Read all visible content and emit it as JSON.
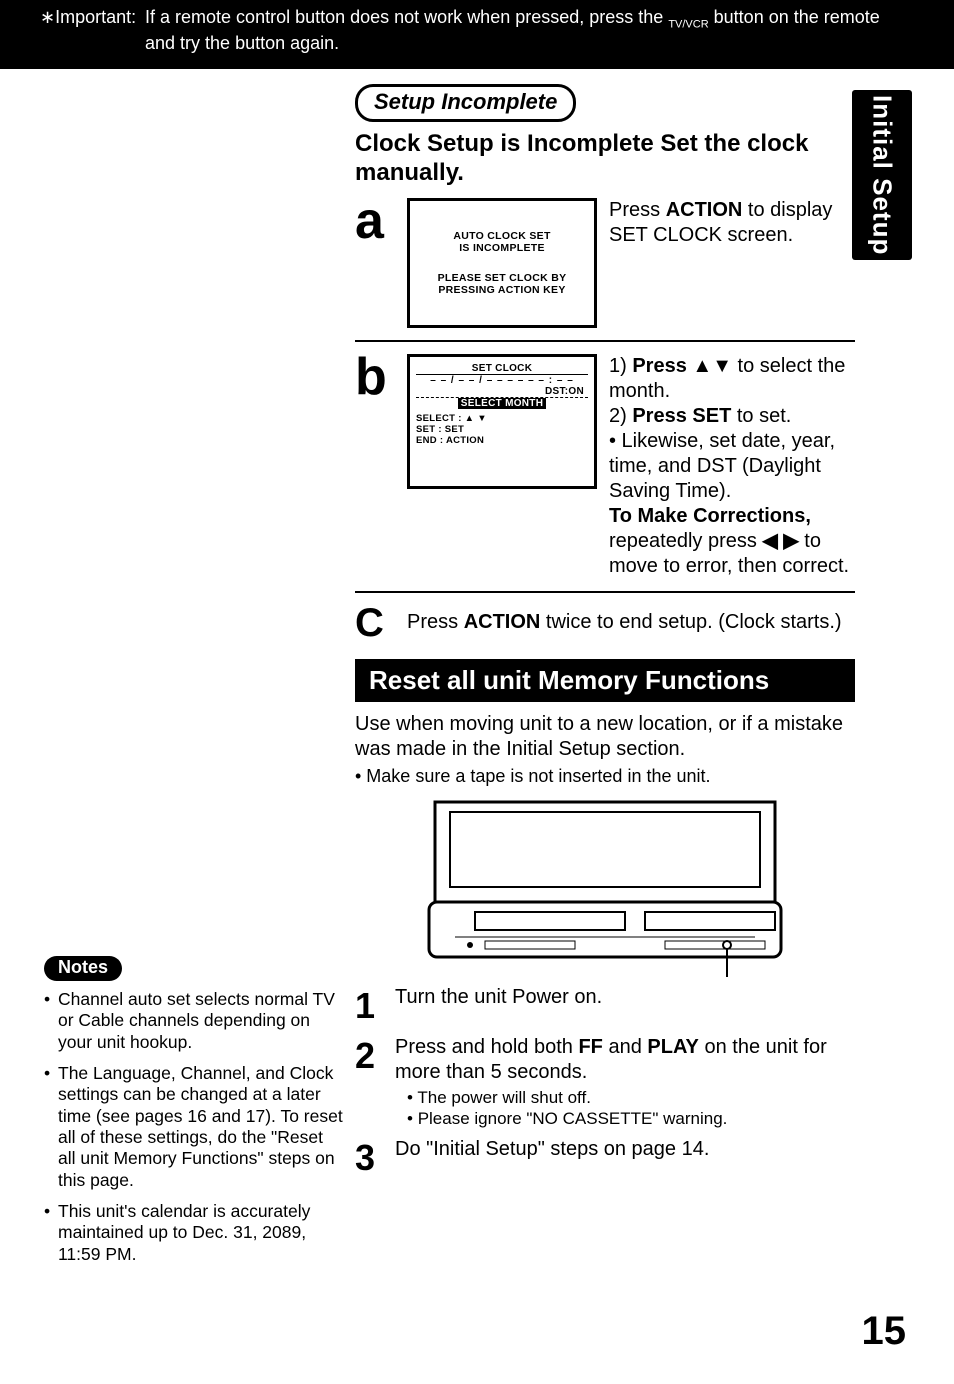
{
  "banner": {
    "prefix": "∗Important:",
    "text_part1": "If a remote control button does not work when pressed, press the ",
    "tvvcr": "TV/VCR",
    "text_part2": " button on the remote and try the button again."
  },
  "side_tab": "Initial Setup",
  "setup_incomplete": {
    "pill": "Setup Incomplete",
    "heading": "Clock Setup is Incomplete Set the clock manually.",
    "step_a": {
      "letter": "a",
      "osd_line1": "AUTO CLOCK SET",
      "osd_line2": "IS INCOMPLETE",
      "osd_line3": "PLEASE SET CLOCK BY",
      "osd_line4": "PRESSING ACTION KEY",
      "desc_prefix": "Press ",
      "desc_bold": "ACTION",
      "desc_suffix": " to display SET CLOCK screen."
    },
    "step_b": {
      "letter": "b",
      "osd_title": "SET CLOCK",
      "osd_dashes": "– – / – – / – – – –     – – : – –",
      "osd_dst": "DST:ON",
      "osd_select_month": "SELECT MONTH",
      "osd_legend1": "SELECT : ▲ ▼",
      "osd_legend2": "SET        : SET",
      "osd_legend3": "END       : ACTION",
      "line1_pre": "1) ",
      "line1_bold": "Press ▲▼",
      "line1_post": " to select the month.",
      "line2_pre": "2) ",
      "line2_bold": "Press SET",
      "line2_post": " to set.",
      "bullet": "• Likewise, set date, year, time, and DST (Daylight Saving Time).",
      "corr_bold": "To Make Corrections,",
      "corr_rest_pre": "repeatedly press ",
      "corr_arrows": "◀ ▶",
      "corr_rest_post": " to move to error, then correct."
    },
    "step_c": {
      "letter": "C",
      "pre": "Press ",
      "bold": "ACTION",
      "post": " twice to end setup. (Clock starts.)"
    }
  },
  "reset": {
    "bar": "Reset all unit Memory Functions",
    "intro": "Use when moving unit to a new location, or if a mistake was made in the Initial Setup section.",
    "intro_bullet": "• Make sure a tape is not inserted in the unit.",
    "step1": {
      "num": "1",
      "txt": "Turn the unit Power on."
    },
    "step2": {
      "num": "2",
      "txt_pre": "Press and hold both ",
      "ff": "FF",
      "mid": " and ",
      "play": "PLAY",
      "txt_post": " on the unit for more than 5 seconds.",
      "sub1": "The power will shut off.",
      "sub2": "Please ignore \"NO CASSETTE\" warning."
    },
    "step3": {
      "num": "3",
      "txt": "Do \"Initial Setup\" steps on page 14."
    }
  },
  "notes": {
    "label": "Notes",
    "items": [
      "Channel auto set selects normal TV or Cable channels depending on your unit hookup.",
      "The Language, Channel, and Clock settings can be changed at a later time (see pages 16 and 17). To reset all of these settings, do the \"Reset all unit Memory Functions\" steps on this page.",
      "This unit's calendar is accurately maintained up to Dec. 31, 2089, 11:59 PM."
    ]
  },
  "page_number": "15"
}
